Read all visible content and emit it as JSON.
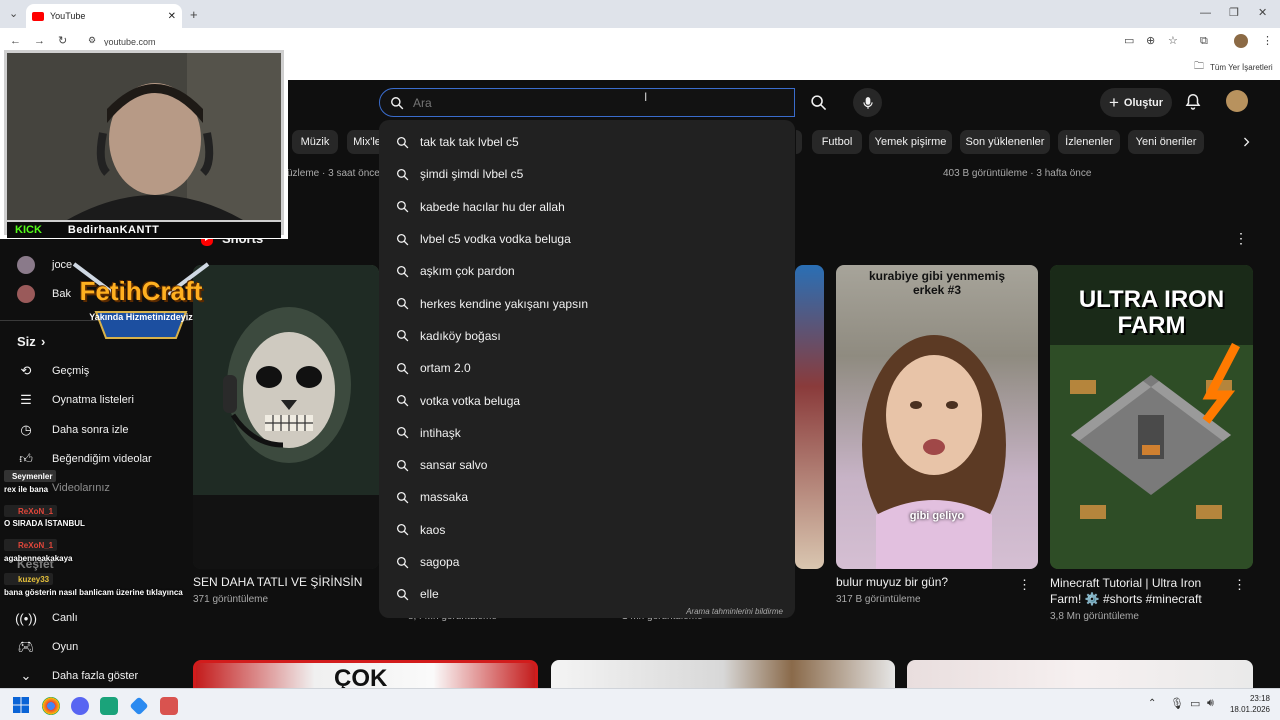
{
  "browser": {
    "tab_title": "YouTube",
    "address": "youtube.com",
    "bookmarks_all": "Tüm Yer İşaretleri"
  },
  "youtube": {
    "search_placeholder": "Ara",
    "create_label": "Oluştur",
    "chips": [
      "Müzik",
      "Mix'le",
      "Futbol",
      "Yemek pişirme",
      "Son yüklenenler",
      "İzlenenler",
      "Yeni öneriler"
    ],
    "suggestions": [
      "tak tak tak lvbel c5",
      "şimdi şimdi lvbel c5",
      "kabede hacılar hu der allah",
      "lvbel c5 vodka vodka beluga",
      "aşkım çok pardon",
      "herkes kendine yakışanı yapsın",
      "kadıköy boğası",
      "ortam 2.0",
      "votka votka beluga",
      "intihaşk",
      "sansar salvo",
      "massaka",
      "kaos",
      "sagopa",
      "elle"
    ],
    "report_predictions": "Arama tahminlerini bildirme",
    "top_meta_left": "üzleme · 3 saat önce",
    "top_meta_right": "403 B görüntüleme · 3 hafta önce",
    "shorts_label": "Shorts",
    "subscriptions": [
      "joce",
      "Bak"
    ],
    "you_header": "Siz",
    "sidebar": [
      {
        "icon": "history-icon",
        "label": "Geçmiş"
      },
      {
        "icon": "playlist-icon",
        "label": "Oynatma listeleri"
      },
      {
        "icon": "watch-later-icon",
        "label": "Daha sonra izle"
      },
      {
        "icon": "like-icon",
        "label": "Beğendiğim videolar"
      },
      {
        "icon": "video-icon",
        "label": "Videolarınız"
      }
    ],
    "explore_header": "Keşfet",
    "explore": [
      {
        "icon": "live-icon",
        "label": "Canlı"
      },
      {
        "icon": "game-icon",
        "label": "Oyun"
      },
      {
        "icon": "chevron-down-icon",
        "label": "Daha fazla göster"
      }
    ],
    "shorts": [
      {
        "title": "SEN DAHA TATLI VE ŞİRİNSİN",
        "views": "371 görüntüleme"
      },
      {
        "title": "",
        "views": "8,4 Mn görüntüleme"
      },
      {
        "title": "",
        "views": "1 Mn görüntüleme"
      },
      {
        "title": "bulur muyuz bir gün?",
        "views": "317 B görüntüleme",
        "overlay_top": "kurabiye gibi yenmemiş erkek #3",
        "overlay_bottom": "gibi geliyo"
      },
      {
        "title": "Minecraft Tutorial | Ultra Iron Farm! ⚙️ #shorts #minecraft",
        "views": "3,8 Mn görüntüleme",
        "overlay_top": "ULTRA IRON FARM"
      }
    ],
    "bottom_thumb_text": "ÇOK"
  },
  "stream_overlay": {
    "platform": "KICK",
    "streamer": "BedirhanKANTT",
    "logo_title": "FetihCraft",
    "logo_subtitle": "Yakında Hizmetinizdeyiz",
    "chat": [
      {
        "user": "Seymenler",
        "msg": "rex ile bana"
      },
      {
        "user": "",
        "msg": "O SIRADA İSTANBUL"
      },
      {
        "user": "ReXoN_1",
        "msg": ""
      },
      {
        "user": "ReXoN_1",
        "msg": "agabenneakakaya"
      },
      {
        "user": "kuzey33",
        "msg": "bana gösterin nasıl banlicam üzerine tıklayınca"
      }
    ]
  },
  "taskbar": {
    "time": "23:18",
    "date": "18.01.2026"
  }
}
